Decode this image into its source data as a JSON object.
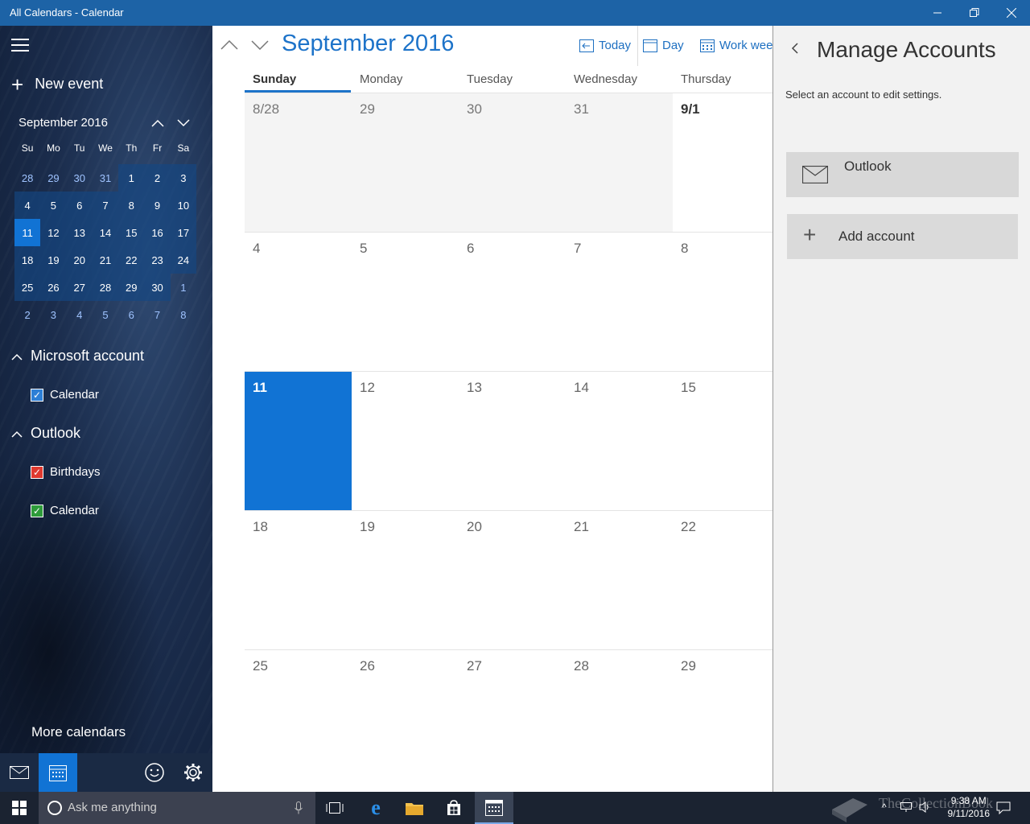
{
  "window": {
    "title": "All Calendars - Calendar"
  },
  "sidebar": {
    "new_event": "New event",
    "mini_month": "September 2016",
    "dow": [
      "Su",
      "Mo",
      "Tu",
      "We",
      "Th",
      "Fr",
      "Sa"
    ],
    "weeks": [
      [
        "28",
        "29",
        "30",
        "31",
        "1",
        "2",
        "3"
      ],
      [
        "4",
        "5",
        "6",
        "7",
        "8",
        "9",
        "10"
      ],
      [
        "11",
        "12",
        "13",
        "14",
        "15",
        "16",
        "17"
      ],
      [
        "18",
        "19",
        "20",
        "21",
        "22",
        "23",
        "24"
      ],
      [
        "25",
        "26",
        "27",
        "28",
        "29",
        "30",
        "1"
      ],
      [
        "2",
        "3",
        "4",
        "5",
        "6",
        "7",
        "8"
      ]
    ],
    "sections": [
      {
        "name": "Microsoft account",
        "calendars": [
          {
            "label": "Calendar",
            "color": "#2d7fd6"
          }
        ]
      },
      {
        "name": "Outlook",
        "calendars": [
          {
            "label": "Birthdays",
            "color": "#e03a2f"
          },
          {
            "label": "Calendar",
            "color": "#2e9b3a"
          }
        ]
      }
    ],
    "more_calendars": "More calendars"
  },
  "main": {
    "month_title": "September 2016",
    "today_label": "Today",
    "day_label": "Day",
    "workweek_label": "Work week",
    "day_headers": [
      "Sunday",
      "Monday",
      "Tuesday",
      "Wednesday",
      "Thursday"
    ],
    "weeks": [
      [
        "8/28",
        "29",
        "30",
        "31",
        "9/1"
      ],
      [
        "4",
        "5",
        "6",
        "7",
        "8"
      ],
      [
        "11",
        "12",
        "13",
        "14",
        "15"
      ],
      [
        "18",
        "19",
        "20",
        "21",
        "22"
      ],
      [
        "25",
        "26",
        "27",
        "28",
        "29"
      ]
    ]
  },
  "panel": {
    "title": "Manage Accounts",
    "subtitle": "Select an account to edit settings.",
    "account": "Outlook",
    "add_account": "Add account"
  },
  "taskbar": {
    "search_placeholder": "Ask me anything",
    "time": "9:38 AM",
    "date": "9/11/2016",
    "watermark": "TheCollectionBook"
  },
  "colors": {
    "accent": "#1173d4",
    "titlebar": "#1d63a6"
  }
}
